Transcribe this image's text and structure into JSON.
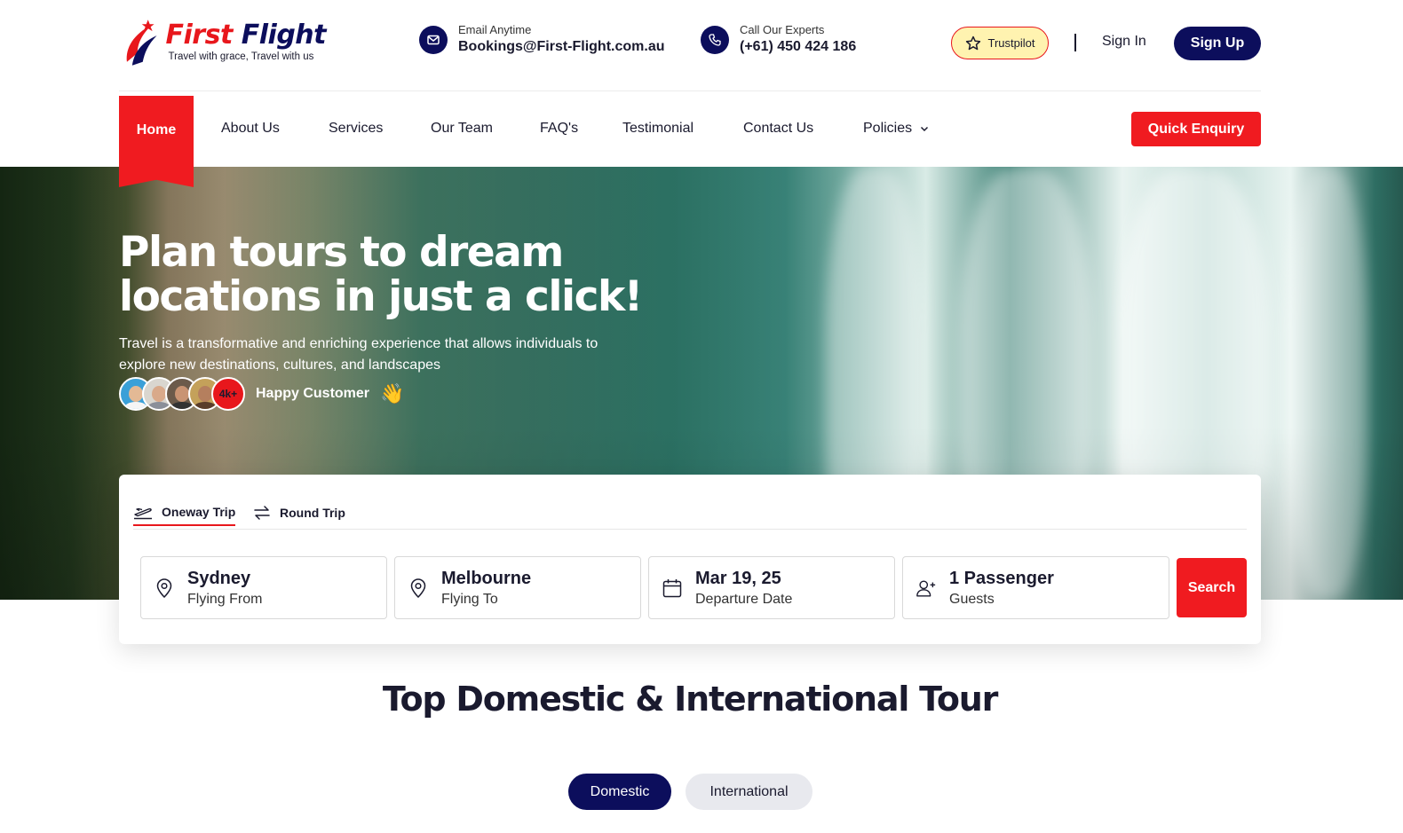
{
  "brand": {
    "name_first": "First",
    "name_second": "Flight",
    "tagline": "Travel with grace, Travel with us",
    "colors": {
      "red": "#e8171c",
      "navy": "#0c0e5c"
    }
  },
  "header": {
    "email": {
      "label": "Email Anytime",
      "value": "Bookings@First-Flight.com.au",
      "icon": "mail-icon"
    },
    "phone": {
      "label": "Call Our Experts",
      "value": "(+61) 450 424 186",
      "icon": "phone-icon"
    },
    "trustpilot": "Trustpilot",
    "sign_in": "Sign In",
    "sign_up": "Sign Up"
  },
  "nav": {
    "items": [
      "Home",
      "About Us",
      "Services",
      "Our Team",
      "FAQ's",
      "Testimonial",
      "Contact Us",
      "Policies"
    ],
    "active": "Home",
    "quick_enquiry": "Quick Enquiry"
  },
  "hero": {
    "title": "Plan tours to dream locations in just a click!",
    "subtitle": "Travel is a transformative and enriching experience that allows individuals to explore new destinations, cultures, and landscapes",
    "customer_count": "4k+",
    "happy_label": "Happy Customer",
    "wave_emoji": "👋"
  },
  "search": {
    "tabs": [
      {
        "label": "Oneway Trip",
        "icon": "plane-takeoff-icon",
        "active": true
      },
      {
        "label": "Round Trip",
        "icon": "swap-arrows-icon",
        "active": false
      }
    ],
    "fields": [
      {
        "value": "Sydney",
        "label": "Flying From",
        "icon": "location-pin-icon"
      },
      {
        "value": "Melbourne",
        "label": "Flying To",
        "icon": "location-pin-icon"
      },
      {
        "value": "Mar 19, 25",
        "label": "Departure Date",
        "icon": "calendar-icon"
      },
      {
        "value": "1 Passenger",
        "label": "Guests",
        "icon": "add-user-icon"
      }
    ],
    "search_button": "Search"
  },
  "tours": {
    "title": "Top Domestic & International Tour",
    "filters": [
      "Domestic",
      "International"
    ],
    "active_filter": "Domestic"
  }
}
